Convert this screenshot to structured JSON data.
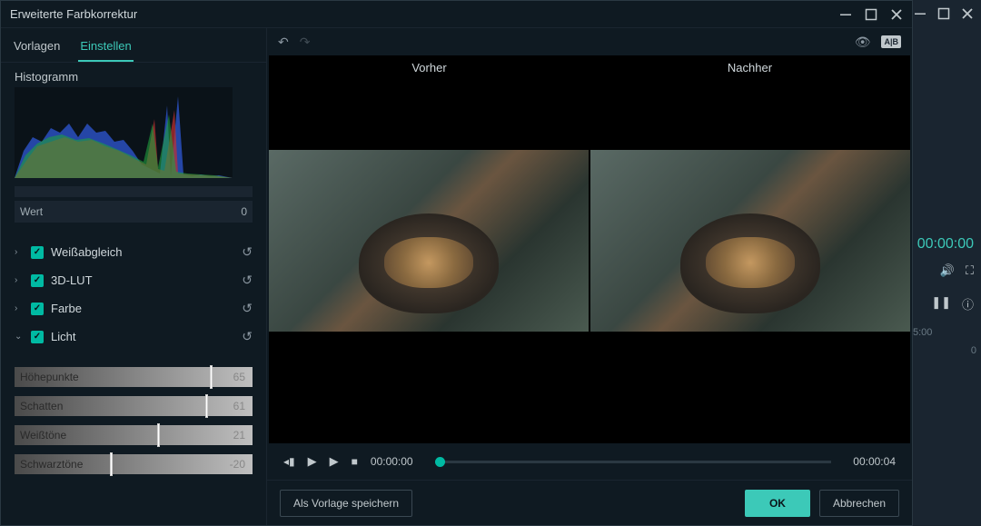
{
  "window": {
    "title": "Erweiterte Farbkorrektur"
  },
  "tabs": {
    "templates": "Vorlagen",
    "settings": "Einstellen"
  },
  "histogram": {
    "title": "Histogramm"
  },
  "wert": {
    "label": "Wert",
    "value": "0"
  },
  "properties": {
    "white_balance": "Weißabgleich",
    "lut": "3D-LUT",
    "color": "Farbe",
    "light": "Licht"
  },
  "adjustments": {
    "highlights": {
      "label": "Höhepunkte",
      "value": "65",
      "pos": 82
    },
    "shadows": {
      "label": "Schatten",
      "value": "61",
      "pos": 80
    },
    "whites": {
      "label": "Weißtöne",
      "value": "21",
      "pos": 60
    },
    "blacks": {
      "label": "Schwarztöne",
      "value": "-20",
      "pos": 40
    }
  },
  "compare": {
    "before": "Vorher",
    "after": "Nachher"
  },
  "playback": {
    "current": "00:00:00",
    "duration": "00:00:04"
  },
  "buttons": {
    "save_template": "Als Vorlage speichern",
    "ok": "OK",
    "cancel": "Abbrechen"
  },
  "back": {
    "time": "00:00:00",
    "ruler1": "5:00",
    "ruler2": "0"
  }
}
